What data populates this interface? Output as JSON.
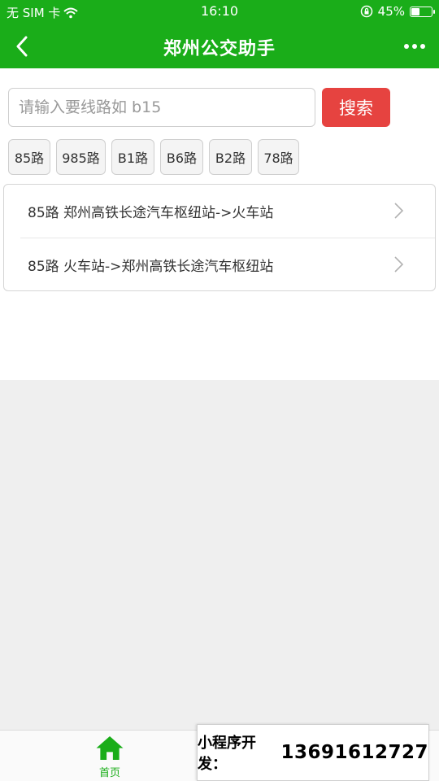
{
  "status_bar": {
    "carrier": "无 SIM 卡",
    "time": "16:10",
    "battery_percent": "45%",
    "battery_level": 0.45
  },
  "nav": {
    "title": "郑州公交助手"
  },
  "search": {
    "placeholder": "请输入要线路如 b15",
    "value": "",
    "button_label": "搜索"
  },
  "quick_tags": [
    "85路",
    "985路",
    "B1路",
    "B6路",
    "B2路",
    "78路"
  ],
  "routes": [
    {
      "label": "85路 郑州高铁长途汽车枢纽站->火车站"
    },
    {
      "label": "85路 火车站->郑州高铁长途汽车枢纽站"
    }
  ],
  "tab_bar": {
    "home_label": "首页"
  },
  "promo": {
    "label": "小程序开发：",
    "phone": "13691612727"
  },
  "colors": {
    "brand_green": "#1aad19",
    "search_red": "#e64340",
    "background_grey": "#efefef"
  }
}
